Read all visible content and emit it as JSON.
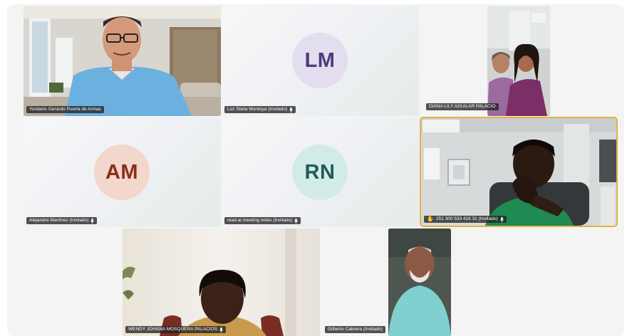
{
  "meeting": {
    "active_color": "#e3b340",
    "participants": [
      {
        "id": "yordanis",
        "name": "Yordanis Gerardo Puerta de Armas",
        "video": true,
        "mic_icon": false
      },
      {
        "id": "lm",
        "name": "Luz Stella Montoya (Invitado)",
        "initials": "LM",
        "avatar_bg": "#e2def0",
        "avatar_fg": "#4c3a78",
        "video": false,
        "mic_icon": true
      },
      {
        "id": "diana",
        "name": "DIANA LILY AGUILAR PALACIO",
        "video": true,
        "mic_icon": false
      },
      {
        "id": "am",
        "name": "Alejandra Martínez (Invitado)",
        "initials": "AM",
        "avatar_bg": "#f3d6cc",
        "avatar_fg": "#8a2e1c",
        "video": false,
        "mic_icon": true
      },
      {
        "id": "rn",
        "name": "read.ai meeting notes (Invitado)",
        "initials": "RN",
        "avatar_bg": "#d3ebe7",
        "avatar_fg": "#1f5d57",
        "video": false,
        "mic_icon": true
      },
      {
        "id": "phone",
        "name": "251 300 533 416 31 (Invitado)",
        "video": true,
        "mic_icon": true,
        "hand_raised": true,
        "hand_icon": "raised-hand-icon",
        "active_speaker": true
      },
      {
        "id": "wendy",
        "name": "WENDY JOHANA MOSQUERA PALACIOS",
        "video": true,
        "mic_icon": true
      },
      {
        "id": "gilberto",
        "name": "Gilberto Cabrera (Invitado)",
        "video": true,
        "mic_icon": false
      }
    ]
  }
}
